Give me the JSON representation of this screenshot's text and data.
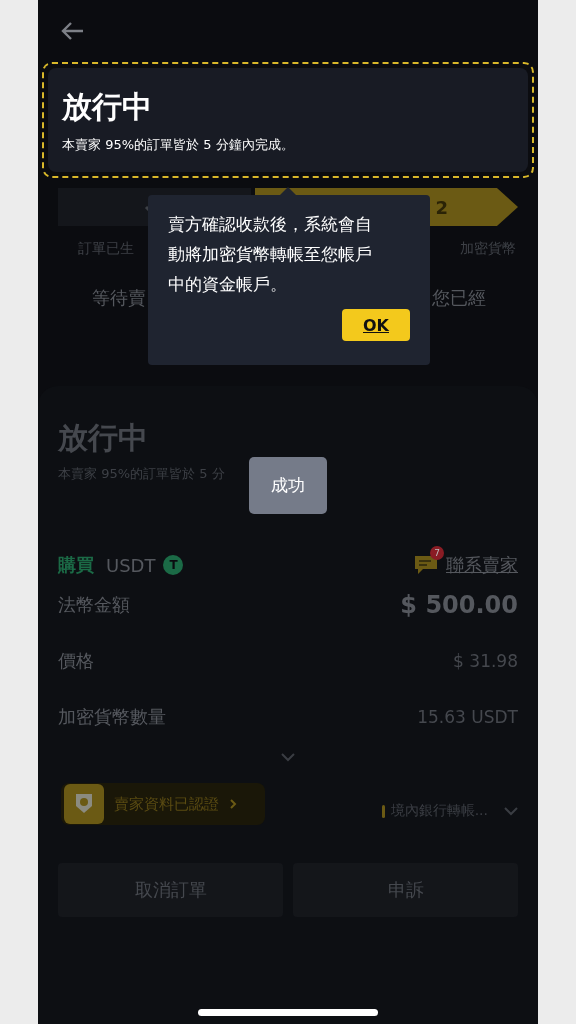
{
  "highlight": {
    "title": "放行中",
    "subtitle": "本賣家 95%的訂單皆於 5 分鐘內完成。"
  },
  "steps": [
    {
      "kind": "done",
      "label": "訂單已生"
    },
    {
      "kind": "current",
      "number": "2",
      "label": "加密貨幣"
    }
  ],
  "status_text": {
    "left": "等待賣",
    "right": "您已經"
  },
  "tooltip": {
    "text": "賣方確認收款後，系統會自動將加密貨幣轉帳至您帳戶中的資金帳戶。",
    "button": "OK"
  },
  "sheet": {
    "title": "放行中",
    "subtitle": "本賣家 95%的訂單皆於 5 分"
  },
  "toast": "成功",
  "trade": {
    "side": "購買",
    "asset": "USDT",
    "asset_icon": "T",
    "unread": "7",
    "contact": "聯系賣家"
  },
  "details": [
    {
      "kind": "total",
      "label": "法幣金額",
      "value": "$ 500.00"
    },
    {
      "kind": "plain",
      "label": "價格",
      "value": "$ 31.98"
    },
    {
      "kind": "plain",
      "label": "加密貨幣數量",
      "value": "15.63 USDT"
    }
  ],
  "verified": "賣家資料已認證",
  "payment": "境內銀行轉帳...",
  "actions": [
    "取消訂單",
    "申訴"
  ]
}
